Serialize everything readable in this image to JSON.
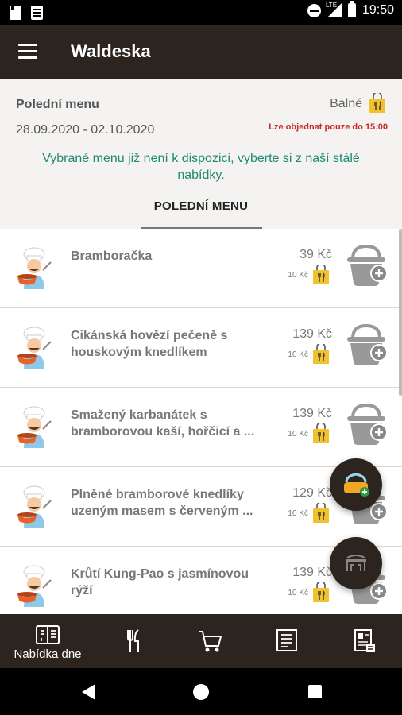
{
  "status_bar": {
    "time": "19:50",
    "network": "LTE"
  },
  "app_bar": {
    "title": "Waldeska"
  },
  "header": {
    "title": "Polední menu",
    "packaging_label": "Balné",
    "date_range": "28.09.2020 - 02.10.2020",
    "order_limit": "Lze objednat pouze do 15:00",
    "notice": "Vybrané menu již není k dispozici, vyberte si z naší stálé nabídky.",
    "tab": "POLEDNÍ MENU"
  },
  "items": [
    {
      "name": "Bramboračka",
      "price": "39 Kč",
      "packaging": "10 Kč"
    },
    {
      "name": "Cikánská hovězí pečeně s houskovým knedlíkem",
      "price": "139 Kč",
      "packaging": "10 Kč"
    },
    {
      "name": "Smažený karbanátek s bramborovou kaší, hořčicí a ...",
      "price": "139 Kč",
      "packaging": "10 Kč"
    },
    {
      "name": "Plněné bramborové knedlíky uzeným masem s červeným ...",
      "price": "129 Kč",
      "packaging": "10 Kč"
    },
    {
      "name": "Krůtí Kung-Pao s jasmínovou rýží",
      "price": "139 Kč",
      "packaging": "10 Kč"
    }
  ],
  "bottom_nav": {
    "items": [
      {
        "label": "Nabídka dne",
        "icon": "daily-menu-icon"
      },
      {
        "label": "",
        "icon": "cutlery-icon"
      },
      {
        "label": "",
        "icon": "cart-icon"
      },
      {
        "label": "",
        "icon": "receipt-icon"
      },
      {
        "label": "",
        "icon": "profile-card-icon"
      }
    ]
  },
  "colors": {
    "primary_dark": "#2b241f",
    "notice_green": "#1f8a70",
    "warning_red": "#c62828",
    "bag_yellow": "#f2c12e"
  }
}
